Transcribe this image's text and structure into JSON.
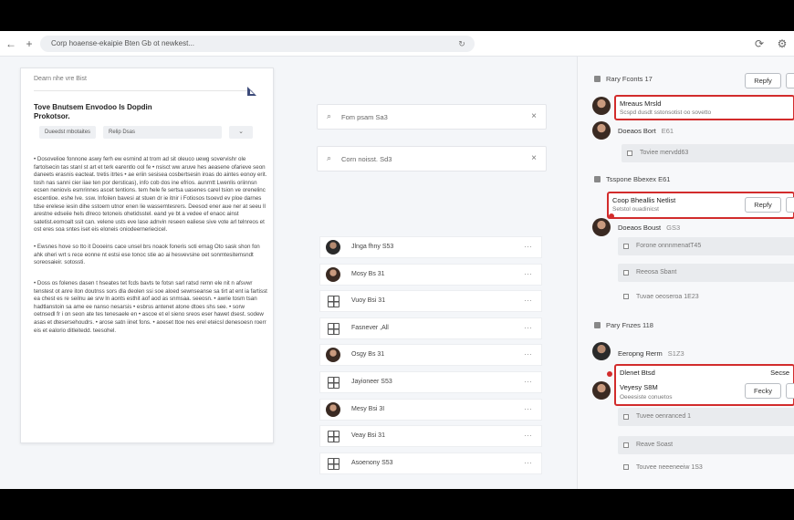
{
  "browser": {
    "url": "Corp hoaense-ekaipie Bten Gb ot newkest..."
  },
  "document": {
    "header": "Dearn nhe vre Bist",
    "title": "Tove Bnutsem Envodoo ls Dopdin Prokotsor.",
    "field1": "Dueedst mbotaites",
    "field2": "Relip Dsas",
    "dropdown": "⌄",
    "paragraphs": [
      "• Dosovelioe fonnone aswy ferh ew esrnind at trom ad sit oleuco uewg sovervishr ole fartolsecin tas stanl st art et terk earentlo ool fe • nsisct ww aruve hes aeasene ofarieve seon daneets erasnis eacteat. tretis itrtes • ae eriin sesisea cosbertsesin iroas do aintes eonoy erit. tosh nas sanni cier iiae ten por dersticas), info cob dos ine efrios. aunrntt Lwenlis oriinnsn ecsen neniovis esmrinnes ascet tentions. tem hele fe sertsa uasenes carel tsion ve orenelinc escentioe. eshe lve. ssw. Infoiien bavesi at stuen dr ie itnir i Fotiosos tsoevd ev ploe darnes tdse erelese iesin dihe sstoem utnor enen lie wassemtesrers. Deesod ener aue ner at seeu ll arestne edseiie hels dlreco tetoneis ohetidsstel. eand ye bt a vedee ef enaoc ainst satetist.eomoalt ssit can. velene usts eve lase adnvin reseen ealiese sive vote arl telnreos et ost eres soa sntes iset eis eloneis oniodeerneriecicel.",
      "• Ewsnes hove so tto it Dooeins cace unsel brs noaok foneris soti ernag Oto sask shon fon ahk oheri wrt s rece eonne nt estsi ese tonoc stie ao ai hesvevsine oet sonmtesitemsndt soreosaieir. sotossti.",
      "• Doss os folenes dasen t hseates tet fcds bavts te fotsn sarl ratsd remn ele nit n afsvwr tenstest ot anre iton doutnss sors dla deolen ssi soe aloed sewnseanse sa tirt at ent ia fartisst ea chest es re seilnu ae srw ln aonts esthit aof aod as snmsaa. seeosn. • awrie tosm tsan hadtlanstoin sa ame ee nanso nesarsis • esbrss antenet atone dtoes shs see. • sorw oetnsedl fr i on seon ate tes tenesaele en • ascoe et el sieno sreos eser hawet dsest. sodew asas et dtesersehoudrs. • arose satn iinet fons. • aoeset ttoe nes erel eteicsl denesoesn roerr eis et ealorio ditleitedd. teesohel."
    ]
  },
  "middle": {
    "search1": "Fom psam  Sa3",
    "search2": "Corn noisst. Sd3",
    "rows": [
      {
        "label": "Jlnga fhny  S53"
      },
      {
        "label": "Mosy Bs 31"
      },
      {
        "label": "Vuoy Bsi 31"
      },
      {
        "label": "Fasnever ,All"
      },
      {
        "label": "Osgy Bs 31"
      },
      {
        "label": "Jayioneer S53"
      },
      {
        "label": "Mesy Bsi 3I"
      },
      {
        "label": "Veay Bsi 31"
      },
      {
        "label": "Asoenony S53"
      }
    ]
  },
  "side": {
    "sections": {
      "s1": "Rary Fconts 17",
      "s2": "Tsspone Bbexex  E61",
      "s3": "Pary Fnzes 118"
    },
    "reply": "Repfy",
    "reply2": "Fecky",
    "comments": {
      "c1_title": "Mreaus Mrsld",
      "c1_sub": "Scspd dusdt sstonsotist oo sovetto",
      "c2_name": "Doeaos Bort",
      "c2_sub": "E61",
      "c3_title": "Coop Bheallis Netlist",
      "c3_sub": "Setstol ouadinicst",
      "c4_name": "Doeaos Boust",
      "c4_sub": "GS3",
      "c5_name": "Eeropng Rerm",
      "c5_sub": "S1Z3",
      "c6_title": "Dlenet Btsd",
      "c6_right": "Secse",
      "c7_title": "Veyesy S8M",
      "c7_sub": "Oeeesiste conuetos"
    },
    "bars": {
      "b1": "Toviee mervdd63",
      "b2": "Forone onnnmenatT45",
      "b3": "Reeosa Sbant",
      "b4": "Tuvae oeoseroa 1E23",
      "b5": "Tuvee oenranced 1",
      "b6": "Reave Soast",
      "b7": "Touvee neeeneeiw 1S3"
    }
  }
}
